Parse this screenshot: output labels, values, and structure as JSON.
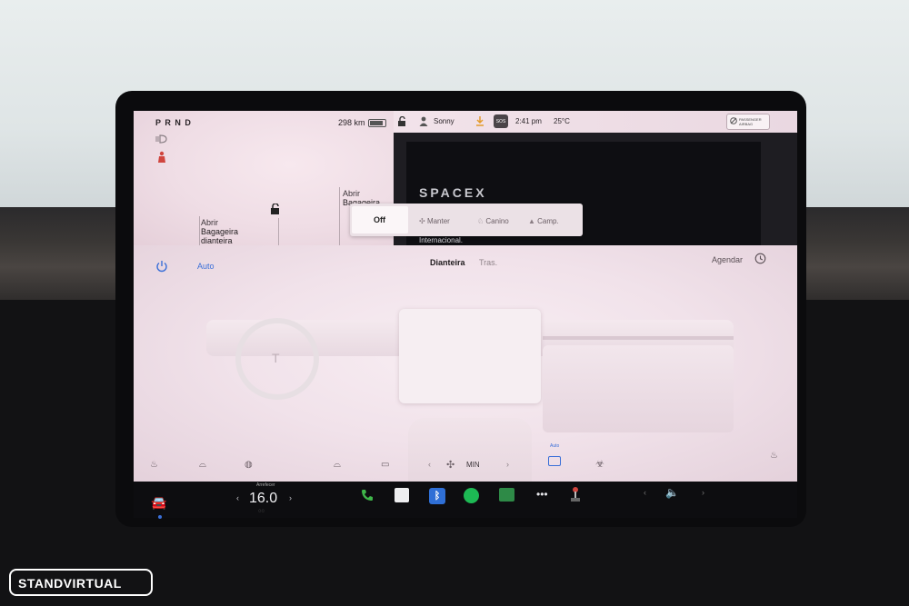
{
  "status": {
    "gear": "P R N D",
    "range": "298 km",
    "user": "Sonny",
    "sos": "SOS",
    "time": "2:41 pm",
    "temp": "25°C",
    "airbag": "PASSENGER AIRBAG"
  },
  "doors": {
    "frunk_line1": "Abrir",
    "frunk_line2": "Bagageira",
    "frunk_line3": "dianteira",
    "trunk_line1": "Abrir",
    "trunk_line2": "Bagageira"
  },
  "media": {
    "logo": "SPACEX",
    "subtitle": "Internacional."
  },
  "climate_modes": {
    "off": "Off",
    "keep": "Manter",
    "dog": "Canino",
    "camp": "Camp."
  },
  "climate": {
    "auto": "Auto",
    "front": "Dianteira",
    "rear": "Tras.",
    "schedule": "Agendar",
    "fan": "MIN",
    "recirc_label": "Auto"
  },
  "taskbar": {
    "temp_label": "Arrefecer",
    "temp_value": "16.0"
  },
  "watermark": "STANDVIRTUAL",
  "colors": {
    "accent_blue": "#3a6fd8",
    "red_icon": "#d0453e",
    "green_phone": "#3fb64a",
    "spotify": "#1db954"
  }
}
